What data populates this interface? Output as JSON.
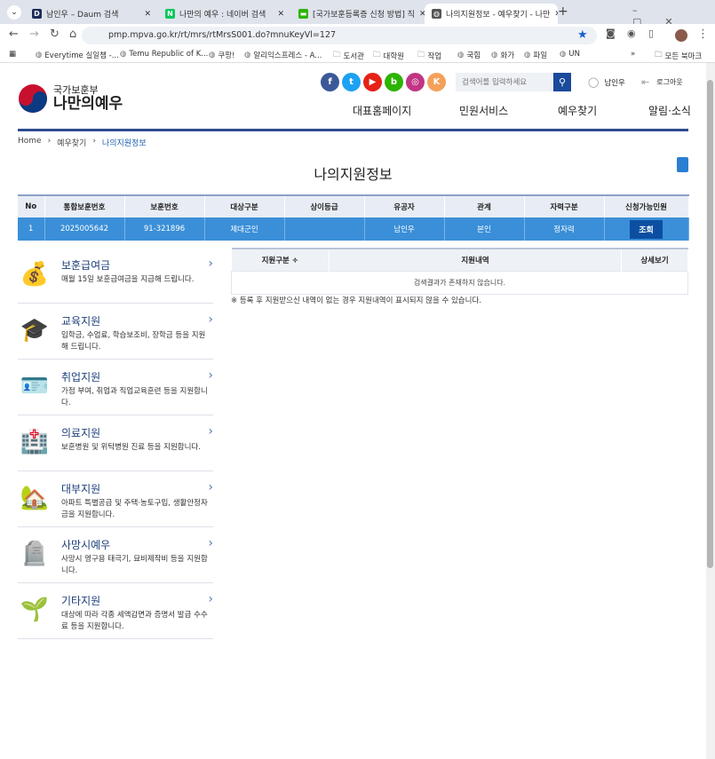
{
  "browser": {
    "tabs": [
      {
        "label": "남인우 – Daum 검색",
        "favicon": "D",
        "color": "#1c2b5a"
      },
      {
        "label": "나만의 예우 : 네이버 검색",
        "favicon": "N",
        "color": "#03c75a"
      },
      {
        "label": "[국가보훈등록증 신청 방법] 직",
        "favicon": "▬",
        "color": "#2db400"
      },
      {
        "label": "나의지원정보 - 예우찾기 - 나만",
        "favicon": "◍",
        "color": "#555"
      }
    ],
    "url": "pmp.mpva.go.kr/rt/mrs/rtMrsS001.do?mnuKeyVl=127",
    "bookmarks": [
      "Everytime 실일챔 -...",
      "Temu Republic of K...",
      "쿠팡!",
      "알리익스프레스 - A...",
      "도서관",
      "대학원",
      "작업",
      "국힘",
      "화가",
      "파일",
      "UN"
    ],
    "all_bookmarks": "모든 북마크"
  },
  "header": {
    "logo_top": "국가보훈부",
    "logo_bottom": "나만의예우",
    "social": [
      {
        "name": "facebook",
        "glyph": "f",
        "color": "#3b5998"
      },
      {
        "name": "twitter",
        "glyph": "t",
        "color": "#1da1f2"
      },
      {
        "name": "youtube",
        "glyph": "▶",
        "color": "#e62117"
      },
      {
        "name": "blog",
        "glyph": "b",
        "color": "#2db400"
      },
      {
        "name": "instagram",
        "glyph": "◎",
        "color": "#c13584"
      },
      {
        "name": "kakao",
        "glyph": "K",
        "color": "#f3a15a"
      }
    ],
    "search_placeholder": "검색어를 입력하세요",
    "user": "남인우",
    "logout": "로그아웃",
    "nav": [
      "대표홈페이지",
      "민원서비스",
      "예우찾기",
      "알림·소식"
    ]
  },
  "breadcrumb": [
    "Home",
    "예우찾기",
    "나의지원정보"
  ],
  "page_title": "나의지원정보",
  "main_table": {
    "headers": [
      "No",
      "통합보훈번호",
      "보훈번호",
      "대상구분",
      "상이등급",
      "유공자",
      "관계",
      "자력구분",
      "신청가능민원"
    ],
    "row": [
      "1",
      "2025005642",
      "91-321896",
      "제대군인",
      "",
      "남인우",
      "본인",
      "정자력"
    ],
    "button": "조회"
  },
  "support_list": [
    {
      "title": "보훈급여금",
      "desc": "매월 15일 보훈급여금을 지급해 드립니다.",
      "icon": "💰"
    },
    {
      "title": "교육지원",
      "desc": "입학금, 수업료, 학습보조비, 장학금 등을 지원해 드립니다.",
      "icon": "🎓"
    },
    {
      "title": "취업지원",
      "desc": "가점 부여, 취업과 직업교육훈련 등을 지원합니다.",
      "icon": "🪪"
    },
    {
      "title": "의료지원",
      "desc": "보훈병원 및 위탁병원 진료 등을 지원합니다.",
      "icon": "🏥"
    },
    {
      "title": "대부지원",
      "desc": "아파트 특별공급 및 주택·농토구입, 생활안정자금을 지원합니다.",
      "icon": "🏡"
    },
    {
      "title": "사망시예우",
      "desc": "사망시 영구용 태극기, 묘비제작비 등을 지원합니다.",
      "icon": "🪦"
    },
    {
      "title": "기타지원",
      "desc": "대상에 따라 각종 세액감면과 증명서 발급 수수료 등을 지원합니다.",
      "icon": "🌱"
    }
  ],
  "sub_table": {
    "headers": [
      "지원구분 ÷",
      "지원내역",
      "상세보기"
    ],
    "empty": "검색결과가 존재하지 않습니다."
  },
  "note": "※ 등록 후 지원받으신 내역이 없는 경우 지원내역이 표시되지 않을 수 있습니다."
}
